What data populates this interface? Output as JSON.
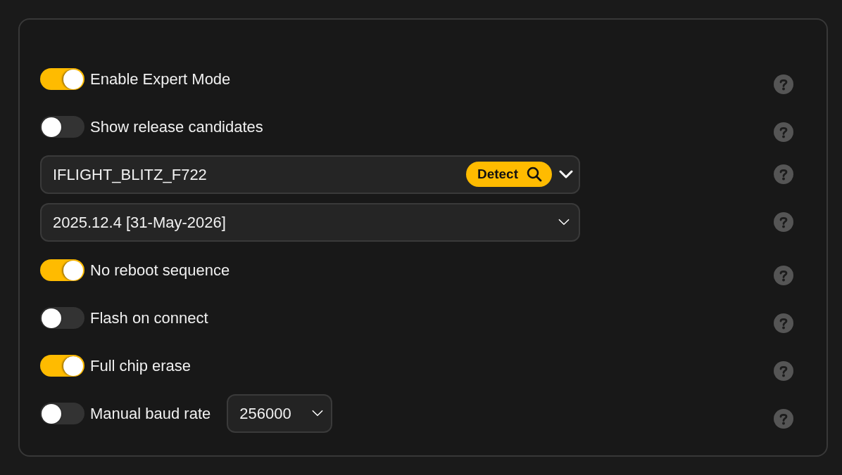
{
  "options": [
    {
      "kind": "toggle",
      "label": "Enable Expert Mode",
      "on": true
    },
    {
      "kind": "toggle",
      "label": "Show release candidates",
      "on": false
    },
    {
      "kind": "select",
      "value": "IFLIGHT_BLITZ_F722",
      "button": "Detect"
    },
    {
      "kind": "select",
      "value": "2025.12.4 [31-May-2026]"
    },
    {
      "kind": "toggle",
      "label": "No reboot sequence",
      "on": true
    },
    {
      "kind": "toggle",
      "label": "Flash on connect",
      "on": false
    },
    {
      "kind": "toggle",
      "label": "Full chip erase",
      "on": true
    },
    {
      "kind": "toggle",
      "label": "Manual baud rate",
      "on": false,
      "select": {
        "value": "256000"
      }
    }
  ]
}
